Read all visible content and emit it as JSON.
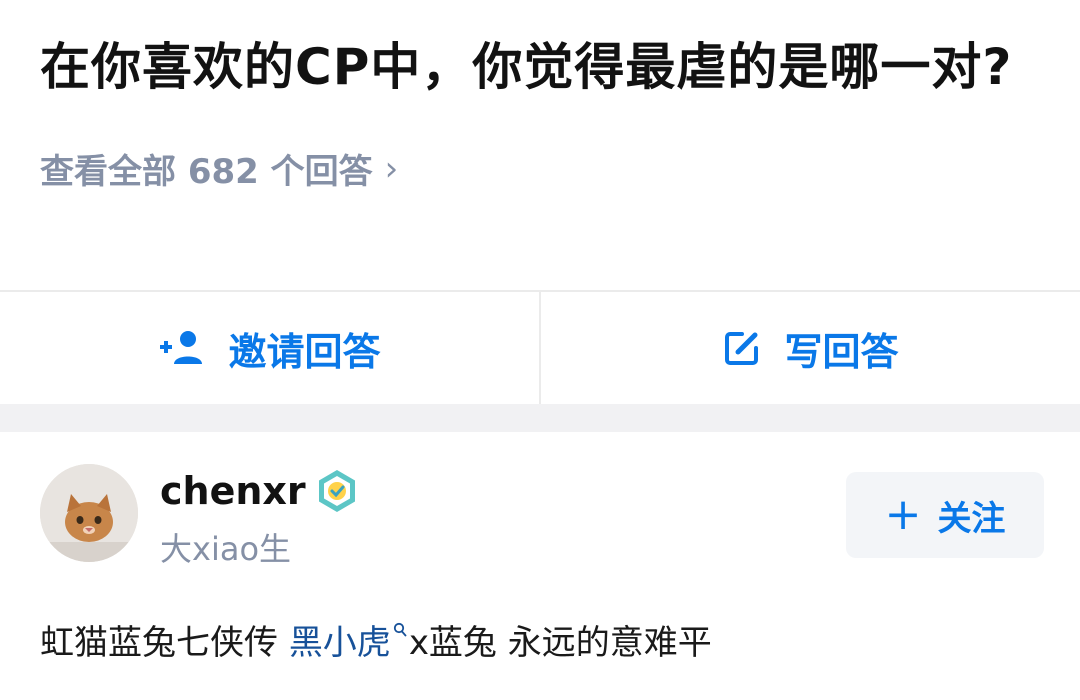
{
  "question": {
    "title": "在你喜欢的CP中，你觉得最虐的是哪一对?",
    "view_all": "查看全部 682 个回答",
    "chevron": "›"
  },
  "actions": {
    "invite_label": "邀请回答",
    "write_label": "写回答"
  },
  "answer": {
    "author_name": "chenxr",
    "author_bio": "大xiao生",
    "follow_label": "关注",
    "follow_plus": "+",
    "excerpt_before": "虹猫蓝兔七侠传 ",
    "excerpt_link": "黑小虎",
    "excerpt_after": "x蓝兔 永远的意难平"
  },
  "colors": {
    "accent": "#0a78e8",
    "link": "#175199",
    "muted": "#8590a6",
    "divider": "#ebebeb",
    "section_gap": "#f1f1f3"
  }
}
